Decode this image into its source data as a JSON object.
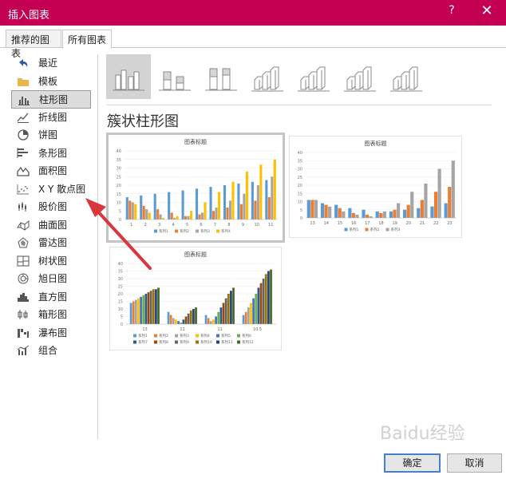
{
  "window": {
    "title": "插入图表",
    "help": "?",
    "close": "✕"
  },
  "tabs": [
    {
      "label": "推荐的图表"
    },
    {
      "label": "所有图表"
    }
  ],
  "sidebar": {
    "items": [
      {
        "label": "最近",
        "icon": "undo-arrow-icon"
      },
      {
        "label": "模板",
        "icon": "folder-icon"
      },
      {
        "label": "柱形图",
        "icon": "column-chart-icon"
      },
      {
        "label": "折线图",
        "icon": "line-chart-icon"
      },
      {
        "label": "饼图",
        "icon": "pie-chart-icon"
      },
      {
        "label": "条形图",
        "icon": "bar-chart-icon"
      },
      {
        "label": "面积图",
        "icon": "area-chart-icon"
      },
      {
        "label": "X Y 散点图",
        "icon": "scatter-chart-icon"
      },
      {
        "label": "股价图",
        "icon": "stock-chart-icon"
      },
      {
        "label": "曲面图",
        "icon": "surface-chart-icon"
      },
      {
        "label": "雷达图",
        "icon": "radar-chart-icon"
      },
      {
        "label": "树状图",
        "icon": "treemap-chart-icon"
      },
      {
        "label": "旭日图",
        "icon": "sunburst-chart-icon"
      },
      {
        "label": "直方图",
        "icon": "histogram-chart-icon"
      },
      {
        "label": "箱形图",
        "icon": "box-whisker-chart-icon"
      },
      {
        "label": "瀑布图",
        "icon": "waterfall-chart-icon"
      },
      {
        "label": "组合",
        "icon": "combo-chart-icon"
      }
    ],
    "selected_index": 2
  },
  "subtypes": {
    "icons": [
      "clustered-column-icon",
      "stacked-column-icon",
      "100-stacked-column-icon",
      "3d-clustered-column-icon",
      "3d-stacked-column-icon",
      "3d-100-stacked-column-icon",
      "3d-column-icon"
    ],
    "selected_index": 0
  },
  "section_title": "簇状柱形图",
  "colors": {
    "accent": "#c30052",
    "s_blue": "#5b9bd5",
    "s_orange": "#ed7d31",
    "s_gray": "#a5a5a5",
    "s_yellow": "#ffc000"
  },
  "previews": [
    {
      "title": "图表标题",
      "categories": [
        "1",
        "2",
        "3",
        "4",
        "5",
        "6",
        "7",
        "8",
        "9",
        "10",
        "11"
      ],
      "yticks": [
        "40",
        "35",
        "30",
        "25",
        "20",
        "15",
        "10",
        "5",
        "0"
      ],
      "series": [
        {
          "name": "系列1",
          "color": "#5b9bd5",
          "values": [
            13,
            14,
            15,
            16,
            17,
            18,
            19,
            20,
            21,
            22,
            23
          ]
        },
        {
          "name": "系列2",
          "color": "#ed7d31",
          "values": [
            11,
            8,
            6,
            4,
            2,
            3,
            5,
            7,
            9,
            11,
            13
          ]
        },
        {
          "name": "系列3",
          "color": "#a5a5a5",
          "values": [
            10,
            6,
            3,
            1,
            2,
            4,
            7,
            11,
            15,
            20,
            25
          ]
        },
        {
          "name": "系列4",
          "color": "#ffc000",
          "values": [
            9,
            4,
            1,
            2,
            5,
            10,
            16,
            22,
            28,
            32,
            35
          ]
        }
      ]
    },
    {
      "title": "图表标题",
      "categories": [
        "13",
        "14",
        "15",
        "16",
        "17",
        "18",
        "19",
        "20",
        "21",
        "22",
        "23"
      ],
      "yticks": [
        "40",
        "35",
        "30",
        "25",
        "20",
        "15",
        "10",
        "5",
        "0"
      ],
      "series": [
        {
          "name": "系列1",
          "color": "#5b9bd5",
          "values": [
            11,
            9,
            8,
            6,
            5,
            4,
            4,
            5,
            6,
            7,
            9
          ]
        },
        {
          "name": "系列2",
          "color": "#ed7d31",
          "values": [
            11,
            8,
            6,
            3,
            2,
            3,
            5,
            8,
            11,
            16,
            19
          ]
        },
        {
          "name": "系列3",
          "color": "#a5a5a5",
          "values": [
            11,
            7,
            4,
            2,
            1,
            4,
            9,
            16,
            21,
            30,
            35
          ]
        }
      ]
    },
    {
      "title": "图表标题",
      "categories": [
        "13",
        "11",
        "11",
        "10.5"
      ],
      "yticks": [
        "40",
        "35",
        "30",
        "25",
        "20",
        "15",
        "10",
        "5",
        "0"
      ],
      "series": [
        {
          "name": "系列1",
          "color": "#5b9bd5",
          "values": [
            14,
            8,
            6,
            6
          ]
        },
        {
          "name": "系列2",
          "color": "#ed7d31",
          "values": [
            15,
            6,
            4,
            8
          ]
        },
        {
          "name": "系列3",
          "color": "#a5a5a5",
          "values": [
            16,
            4,
            2,
            11
          ]
        },
        {
          "name": "系列4",
          "color": "#ffc000",
          "values": [
            17,
            3,
            3,
            14
          ]
        },
        {
          "name": "系列5",
          "color": "#4472c4",
          "values": [
            18,
            2,
            5,
            17
          ]
        },
        {
          "name": "系列6",
          "color": "#70ad47",
          "values": [
            19,
            1,
            8,
            20
          ]
        },
        {
          "name": "系列7",
          "color": "#255e91",
          "values": [
            20,
            3,
            11,
            24
          ]
        },
        {
          "name": "系列8",
          "color": "#9e480e",
          "values": [
            21,
            5,
            14,
            27
          ]
        },
        {
          "name": "系列9",
          "color": "#636363",
          "values": [
            22,
            7,
            17,
            30
          ]
        },
        {
          "name": "系列10",
          "color": "#997300",
          "values": [
            23,
            9,
            20,
            33
          ]
        },
        {
          "name": "系列11",
          "color": "#264478",
          "values": [
            23,
            10,
            22,
            35
          ]
        },
        {
          "name": "系列12",
          "color": "#43682b",
          "values": [
            24,
            11,
            24,
            36
          ]
        }
      ]
    }
  ],
  "buttons": {
    "ok": "确定",
    "cancel": "取消"
  },
  "watermark": "Baidu经验"
}
